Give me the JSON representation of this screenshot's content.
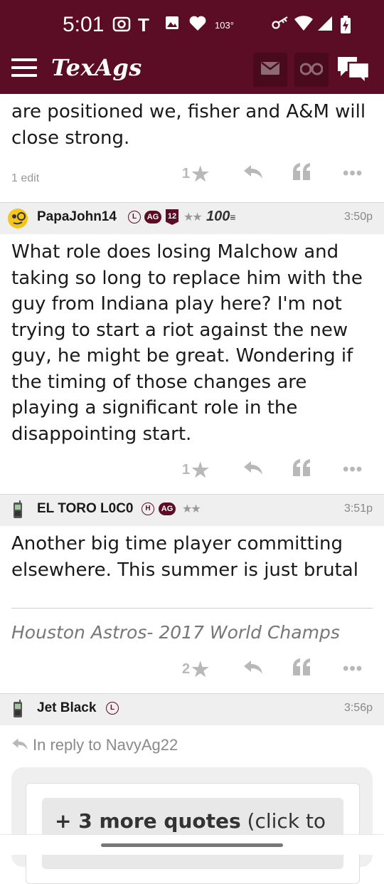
{
  "status_bar": {
    "time": "5:01",
    "temperature": "103°",
    "icons": [
      "screen-record-icon",
      "t-mobile-icon",
      "photo-icon",
      "heart-icon",
      "key-icon",
      "wifi-icon",
      "signal-icon",
      "battery-charging-icon"
    ]
  },
  "app_bar": {
    "title": "TexAgs",
    "icons": [
      "hamburger-menu-icon",
      "mail-icon",
      "binoculars-icon",
      "chat-bubbles-icon"
    ]
  },
  "posts": [
    {
      "text": "are positioned we, fisher and A&M will close strong.",
      "edit_label": "1 edit",
      "stars": "1"
    },
    {
      "username": "PapaJohn14",
      "badges": [
        "L",
        "AG",
        "12",
        "★★",
        "100"
      ],
      "time": "3:50p",
      "text": "What role does losing Malchow and taking so long to replace him with the guy from Indiana play here? I'm not trying to start a riot against the new guy, he might be great. Wondering if the timing of those changes are playing a significant role in the disappointing start.",
      "stars": "1"
    },
    {
      "username": "EL TORO L0C0",
      "badges": [
        "H",
        "AG",
        "★★"
      ],
      "time": "3:51p",
      "text": "Another big time player committing elsewhere. This summer is just brutal",
      "signature": "Houston Astros- 2017 World Champs",
      "stars": "2"
    },
    {
      "username": "Jet Black",
      "badges": [
        "L"
      ],
      "time": "3:56p",
      "reply_to": "In reply to NavyAg22",
      "more_quotes_bold": "+ 3 more quotes",
      "more_quotes_rest": " (click to"
    }
  ],
  "colors": {
    "brand": "#5b0d25",
    "header_bg": "#efefef",
    "action_gray": "#b8b8b8"
  }
}
